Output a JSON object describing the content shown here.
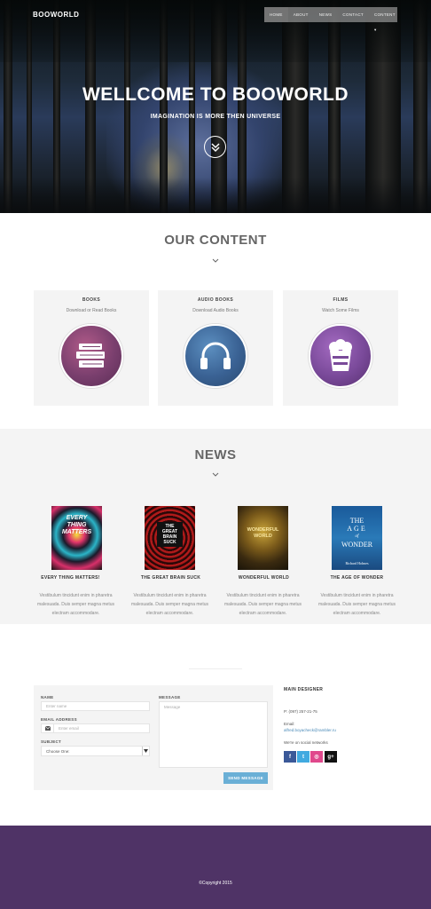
{
  "header": {
    "logo": "BOOWORLD",
    "nav": [
      "HOME",
      "ABOUT",
      "NEWS",
      "CONTACT",
      "CONTENT ▾"
    ],
    "hero_title": "WELLCOME TO BOOWORLD",
    "hero_subtitle": "IMAGINATION IS MORE THEN UNIVERSE"
  },
  "content": {
    "title": "OUR CONTENT",
    "cards": [
      {
        "title": "BOOKS",
        "subtitle": "Download or Read Books",
        "icon": "books-icon",
        "color": "#8b4a7a"
      },
      {
        "title": "AUDIO BOOKS",
        "subtitle": "Download Audio Books",
        "icon": "headphones-icon",
        "color": "#3f6a9a"
      },
      {
        "title": "FILMS",
        "subtitle": "Watch Some Films",
        "icon": "popcorn-icon",
        "color": "#7a4a9a"
      }
    ]
  },
  "news": {
    "title": "NEWS",
    "items": [
      {
        "title": "EVERY THING MATTERS!",
        "text": [
          "Vestibulum tincidunt enim in pharetra",
          "malesuada. Duis semper magna metus",
          "electram accommodare."
        ],
        "cover": [
          "EVERY",
          "THING",
          "MATTERS"
        ]
      },
      {
        "title": "THE GREAT BRAIN SUCK",
        "text": [
          "Vestibulum tincidunt enim in pharetra",
          "malesuada. Duis semper magna metus",
          "electram accommodare."
        ],
        "cover": [
          "THE",
          "GREAT",
          "BRAIN",
          "SUCK"
        ]
      },
      {
        "title": "WONDERFUL WORLD",
        "text": [
          "Vestibulum tincidunt enim in pharetra",
          "malesuada. Duis semper magna metus",
          "electram accommodare."
        ],
        "cover": [
          "WONDERFUL",
          "WORLD"
        ]
      },
      {
        "title": "THE AGE OF WONDER",
        "text": [
          "Vestibulum tincidunt enim in pharetra",
          "malesuada. Duis semper magna metus",
          "electram accommodare."
        ],
        "cover": [
          "THE",
          "AGE",
          "of",
          "WONDER",
          "Richard Holmes"
        ]
      }
    ]
  },
  "contact": {
    "name_label": "NAME",
    "name_placeholder": "Enter name",
    "email_label": "EMAIL ADDRESS",
    "email_placeholder": "Enter email",
    "subject_label": "SUBJECT",
    "subject_value": "Choose One:",
    "message_label": "MESSAGE",
    "message_placeholder": "Message",
    "send_label": "SEND MESSAGE",
    "side_title": "MAIN DESIGNER",
    "phone": "P: (097) 257-21-75",
    "email_label_side": "Email:",
    "email": "alfred.boyacheck@rambler.ru",
    "social_label": "We're on social networks",
    "social": [
      {
        "icon": "facebook-icon",
        "glyph": "f",
        "color": "#3b5998"
      },
      {
        "icon": "twitter-icon",
        "glyph": "t",
        "color": "#41aae0"
      },
      {
        "icon": "dribbble-icon",
        "glyph": "◎",
        "color": "#e0488c"
      },
      {
        "icon": "googleplus-icon",
        "glyph": "g+",
        "color": "#111111"
      }
    ]
  },
  "footer": {
    "copyright": "©Copyright 2015"
  }
}
